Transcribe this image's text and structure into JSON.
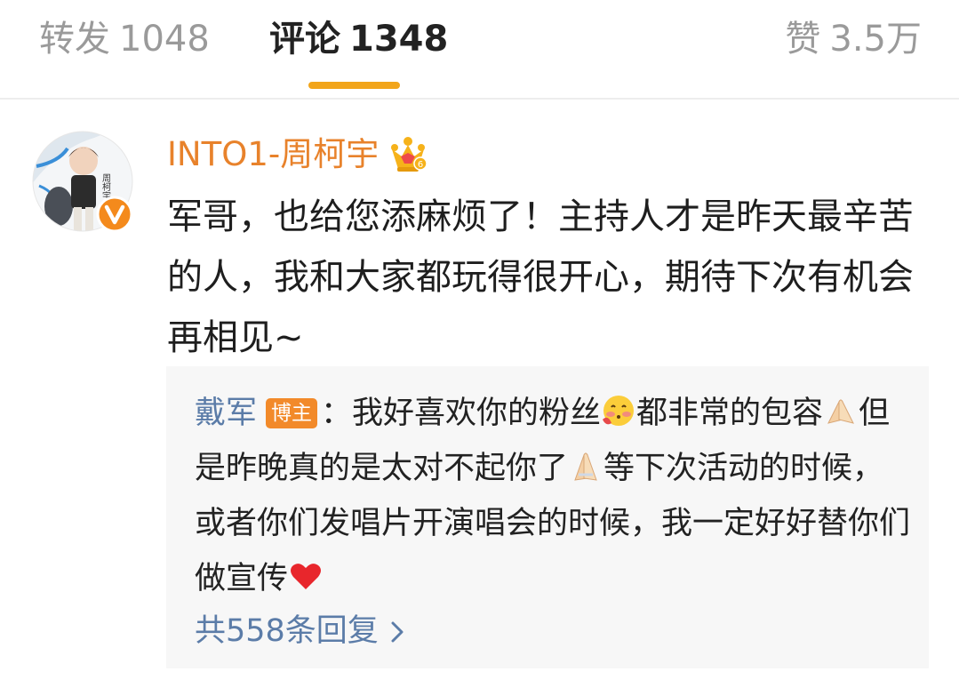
{
  "tabs": {
    "reposts": {
      "label": "转发",
      "count": "1048"
    },
    "comments": {
      "label": "评论",
      "count": "1348"
    },
    "likes": {
      "label": "赞",
      "count": "3.5万"
    }
  },
  "comment": {
    "author": "INTO1-周柯宇",
    "avatar_caption": "周柯宇",
    "text": "军哥，也给您添麻烦了！主持人才是昨天最辛苦的人，我和大家都玩得很开心，期待下次有机会再相见~"
  },
  "reply": {
    "author": "戴军",
    "badge": "博主",
    "text_part1": "：我好喜欢你的粉丝",
    "text_part2": "都非常的包容",
    "text_part3": "但是昨晚真的是太对不起你了",
    "text_part4": "等下次活动的时候，或者你们发唱片开演唱会的时候，我一定好好替你们做宣传",
    "emoji_1": "shy-face-emoji",
    "emoji_2": "folded-hands-emoji",
    "emoji_3": "folded-hands-emoji",
    "emoji_4": "red-heart-emoji"
  },
  "more_replies": "共558条回复",
  "colors": {
    "accent": "#f2a51a",
    "username": "#e8822b",
    "link": "#5b7ca8",
    "badge": "#f28a2a"
  }
}
